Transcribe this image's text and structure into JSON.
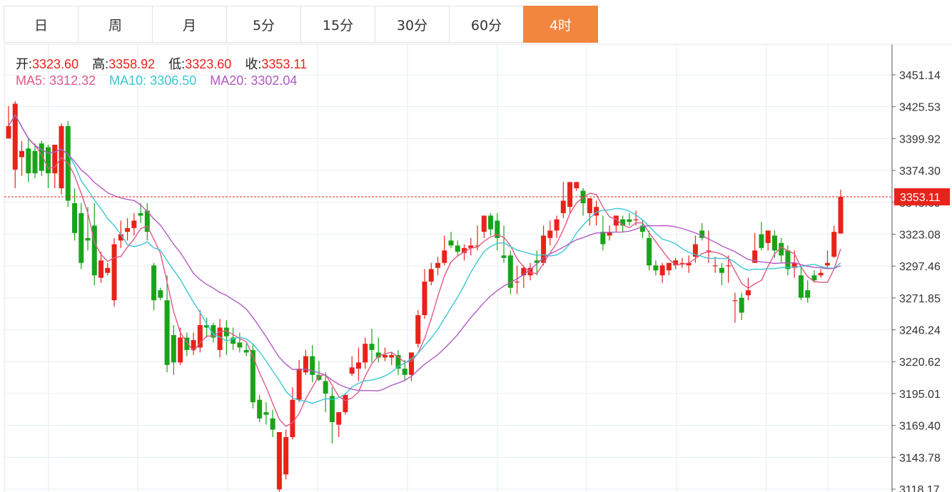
{
  "tabs": [
    {
      "label": "日"
    },
    {
      "label": "周"
    },
    {
      "label": "月"
    },
    {
      "label": "5分"
    },
    {
      "label": "15分"
    },
    {
      "label": "30分"
    },
    {
      "label": "60分"
    },
    {
      "label": "4时",
      "active": true
    }
  ],
  "ohlc_info": {
    "open_label": "开:",
    "open": "3323.60",
    "high_label": "高:",
    "high": "3358.92",
    "low_label": "低:",
    "low": "3323.60",
    "close_label": "收:",
    "close": "3353.11"
  },
  "ma_info": {
    "ma5_label": "MA5:",
    "ma5": "3312.32",
    "ma10_label": "MA10:",
    "ma10": "3306.50",
    "ma20_label": "MA20:",
    "ma20": "3302.04"
  },
  "colors": {
    "up": "#e8231b",
    "down": "#1aa31a",
    "ma5": "#e05a84",
    "ma10": "#3cc6d6",
    "ma20": "#b35ac4",
    "grid": "#e6eef4",
    "active_tab": "#f2863f"
  },
  "chart_data": {
    "type": "candlestick",
    "ylim": [
      3118.17,
      3463
    ],
    "y_ticks": [
      "3451.14",
      "3425.53",
      "3399.92",
      "3374.30",
      "3348.69",
      "3323.08",
      "3297.46",
      "3271.85",
      "3246.24",
      "3220.62",
      "3195.01",
      "3169.40",
      "3143.78",
      "3118.17"
    ],
    "last_price": "3353.11",
    "candles": [
      [
        3400,
        3426,
        3410,
        3427
      ],
      [
        3375,
        3430,
        3428,
        3360
      ],
      [
        3385,
        3398,
        3390,
        3370
      ],
      [
        3392,
        3400,
        3372,
        3365
      ],
      [
        3390,
        3396,
        3372,
        3368
      ],
      [
        3396,
        3398,
        3374,
        3370
      ],
      [
        3393,
        3395,
        3372,
        3360
      ],
      [
        3372,
        3390,
        3395,
        3360
      ],
      [
        3360,
        3412,
        3410,
        3355
      ],
      [
        3410,
        3414,
        3350,
        3345
      ],
      [
        3348,
        3360,
        3324,
        3318
      ],
      [
        3340,
        3348,
        3300,
        3295
      ],
      [
        3320,
        3345,
        3318,
        3310
      ],
      [
        3330,
        3348,
        3290,
        3282
      ],
      [
        3288,
        3309,
        3302,
        3284
      ],
      [
        3292,
        3300,
        3296,
        3290
      ],
      [
        3270,
        3320,
        3315,
        3265
      ],
      [
        3318,
        3334,
        3323,
        3312
      ],
      [
        3325,
        3336,
        3328,
        3318
      ],
      [
        3328,
        3340,
        3334,
        3322
      ],
      [
        3340,
        3348,
        3338,
        3332
      ],
      [
        3342,
        3348,
        3325,
        3318
      ],
      [
        3298,
        3300,
        3270,
        3262
      ],
      [
        3278,
        3280,
        3272,
        3270
      ],
      [
        3270,
        3290,
        3218,
        3212
      ],
      [
        3242,
        3250,
        3220,
        3210
      ],
      [
        3220,
        3248,
        3240,
        3218
      ],
      [
        3240,
        3244,
        3230,
        3225
      ],
      [
        3230,
        3244,
        3238,
        3226
      ],
      [
        3232,
        3262,
        3250,
        3228
      ],
      [
        3250,
        3256,
        3248,
        3240
      ],
      [
        3250,
        3252,
        3240,
        3236
      ],
      [
        3230,
        3255,
        3248,
        3224
      ],
      [
        3248,
        3254,
        3241,
        3226
      ],
      [
        3240,
        3248,
        3235,
        3230
      ],
      [
        3236,
        3244,
        3232,
        3228
      ],
      [
        3230,
        3235,
        3228,
        3225
      ],
      [
        3230,
        3235,
        3188,
        3183
      ],
      [
        3190,
        3194,
        3175,
        3172
      ],
      [
        3180,
        3188,
        3178,
        3170
      ],
      [
        3175,
        3182,
        3166,
        3160
      ],
      [
        3118,
        3132,
        3164,
        3116
      ],
      [
        3130,
        3166,
        3160,
        3126
      ],
      [
        3160,
        3200,
        3190,
        3158
      ],
      [
        3190,
        3222,
        3215,
        3188
      ],
      [
        3212,
        3230,
        3225,
        3210
      ],
      [
        3225,
        3234,
        3210,
        3204
      ],
      [
        3210,
        3221,
        3206,
        3205
      ],
      [
        3205,
        3212,
        3195,
        3180
      ],
      [
        3193,
        3200,
        3172,
        3155
      ],
      [
        3170,
        3180,
        3180,
        3160
      ],
      [
        3180,
        3190,
        3194,
        3178
      ],
      [
        3211,
        3225,
        3216,
        3209
      ],
      [
        3215,
        3232,
        3220,
        3205
      ],
      [
        3220,
        3240,
        3235,
        3215
      ],
      [
        3235,
        3247,
        3230,
        3220
      ],
      [
        3228,
        3240,
        3224,
        3220
      ],
      [
        3224,
        3232,
        3226,
        3221
      ],
      [
        3224,
        3228,
        3226,
        3218
      ],
      [
        3226,
        3230,
        3215,
        3210
      ],
      [
        3215,
        3222,
        3210,
        3205
      ],
      [
        3210,
        3228,
        3228,
        3205
      ],
      [
        3235,
        3262,
        3258,
        3232
      ],
      [
        3258,
        3295,
        3285,
        3255
      ],
      [
        3285,
        3300,
        3295,
        3282
      ],
      [
        3296,
        3305,
        3300,
        3290
      ],
      [
        3300,
        3322,
        3310,
        3298
      ],
      [
        3318,
        3325,
        3314,
        3312
      ],
      [
        3314,
        3318,
        3309,
        3305
      ],
      [
        3308,
        3315,
        3312,
        3302
      ],
      [
        3312,
        3320,
        3314,
        3306
      ],
      [
        3314,
        3330,
        3314,
        3310
      ],
      [
        3325,
        3338,
        3338,
        3320
      ],
      [
        3338,
        3340,
        3327,
        3322
      ],
      [
        3334,
        3340,
        3320,
        3310
      ],
      [
        3306,
        3330,
        3304,
        3300
      ],
      [
        3306,
        3310,
        3280,
        3275
      ],
      [
        3285,
        3298,
        3285,
        3275
      ],
      [
        3290,
        3298,
        3296,
        3280
      ],
      [
        3290,
        3300,
        3296,
        3286
      ],
      [
        3302,
        3310,
        3300,
        3290
      ],
      [
        3300,
        3330,
        3322,
        3298
      ],
      [
        3320,
        3334,
        3326,
        3314
      ],
      [
        3326,
        3338,
        3335,
        3320
      ],
      [
        3340,
        3365,
        3350,
        3336
      ],
      [
        3345,
        3365,
        3365,
        3340
      ],
      [
        3360,
        3363,
        3365,
        3358
      ],
      [
        3358,
        3360,
        3348,
        3338
      ],
      [
        3340,
        3352,
        3352,
        3330
      ],
      [
        3338,
        3350,
        3345,
        3330
      ],
      [
        3325,
        3338,
        3315,
        3310
      ],
      [
        3322,
        3330,
        3325,
        3318
      ],
      [
        3330,
        3338,
        3338,
        3325
      ],
      [
        3335,
        3338,
        3330,
        3325
      ],
      [
        3335,
        3340,
        3333,
        3330
      ],
      [
        3335,
        3342,
        3335,
        3330
      ],
      [
        3330,
        3335,
        3325,
        3320
      ],
      [
        3320,
        3326,
        3298,
        3294
      ],
      [
        3298,
        3302,
        3294,
        3290
      ],
      [
        3290,
        3300,
        3298,
        3284
      ],
      [
        3294,
        3300,
        3300,
        3290
      ],
      [
        3298,
        3304,
        3302,
        3295
      ],
      [
        3300,
        3304,
        3300,
        3296
      ],
      [
        3298,
        3306,
        3300,
        3292
      ],
      [
        3305,
        3322,
        3315,
        3300
      ],
      [
        3326,
        3332,
        3320,
        3318
      ],
      [
        3310,
        3326,
        3310,
        3300
      ],
      [
        3298,
        3305,
        3298,
        3292
      ],
      [
        3296,
        3300,
        3292,
        3282
      ],
      [
        3298,
        3306,
        3298,
        3284
      ],
      [
        3270,
        3276,
        3270,
        3252
      ],
      [
        3272,
        3276,
        3260,
        3254
      ],
      [
        3274,
        3288,
        3278,
        3270
      ],
      [
        3300,
        3324,
        3310,
        3300
      ],
      [
        3323,
        3333,
        3312,
        3310
      ],
      [
        3316,
        3324,
        3326,
        3310
      ],
      [
        3322,
        3326,
        3310,
        3304
      ],
      [
        3316,
        3320,
        3306,
        3300
      ],
      [
        3310,
        3314,
        3295,
        3290
      ],
      [
        3296,
        3310,
        3300,
        3288
      ],
      [
        3290,
        3298,
        3272,
        3270
      ],
      [
        3278,
        3286,
        3272,
        3268
      ],
      [
        3290,
        3294,
        3286,
        3284
      ],
      [
        3290,
        3295,
        3292,
        3288
      ],
      [
        3298,
        3310,
        3300,
        3296
      ],
      [
        3305,
        3330,
        3325,
        3304
      ],
      [
        3323.6,
        3358.92,
        3353.11,
        3323.6
      ]
    ]
  }
}
